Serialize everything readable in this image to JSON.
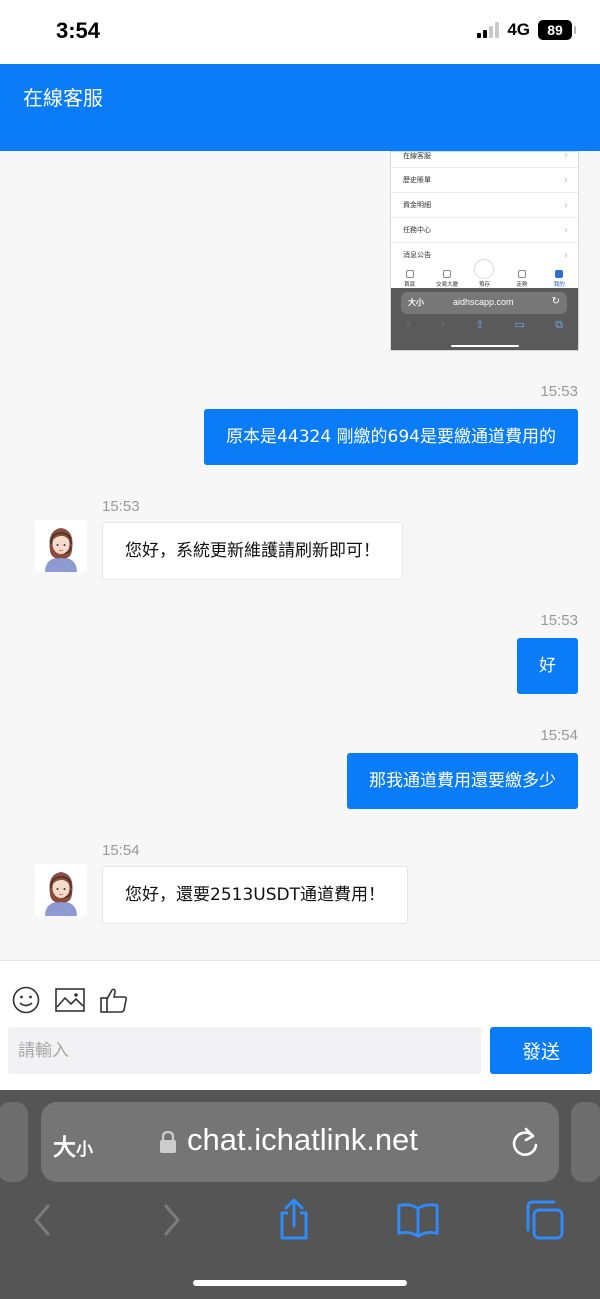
{
  "status_bar": {
    "time": "3:54",
    "network": "4G",
    "battery": "89"
  },
  "header": {
    "title": "在線客服"
  },
  "shared_screenshot": {
    "menu_items": [
      "在線客服",
      "歷史賬單",
      "資金明細",
      "任務中心",
      "消息公告"
    ],
    "tabbar": [
      "首頁",
      "交易大廳",
      "預存",
      "走勢",
      "我的"
    ],
    "url_size": "大小",
    "url": "aidhscapp.com"
  },
  "messages": [
    {
      "side": "me",
      "time": "15:53",
      "text": "原本是44324 剛繳的694是要繳通道費用的"
    },
    {
      "side": "them",
      "time": "15:53",
      "text": "您好，系統更新維護請刷新即可！"
    },
    {
      "side": "me",
      "time": "15:53",
      "text": "好"
    },
    {
      "side": "me",
      "time": "15:54",
      "text": "那我通道費用還要繳多少"
    },
    {
      "side": "them",
      "time": "15:54",
      "text": "您好，還要2513USDT通道費用！"
    }
  ],
  "composer": {
    "tools": [
      "emoji-icon",
      "image-icon",
      "thumbs-up-icon"
    ],
    "placeholder": "請輸入",
    "send_label": "發送"
  },
  "browser": {
    "text_size_label": "大",
    "text_size_small": "小",
    "url": "chat.ichatlink.net"
  }
}
